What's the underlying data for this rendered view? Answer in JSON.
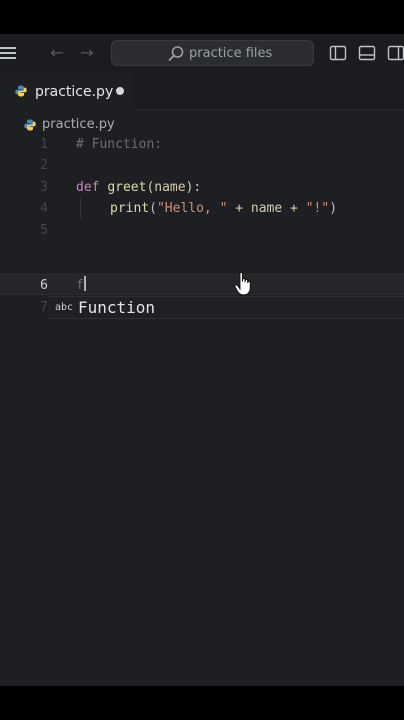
{
  "search": {
    "label": "practice files"
  },
  "tab": {
    "name": "practice.py"
  },
  "breadcrumb": {
    "file": "practice.py"
  },
  "editor": {
    "lines": [
      {
        "n": "1",
        "t": "# Function:"
      },
      {
        "n": "2",
        "t": ""
      },
      {
        "n": "3",
        "kw": "def",
        "fn": "greet",
        "params": "(name):"
      },
      {
        "n": "4",
        "fn": "print",
        "open": "(",
        "s1": "\"Hello, \"",
        "mid": " + name + ",
        "s2": "\"!\"",
        "close": ")"
      },
      {
        "n": "5",
        "t": ""
      },
      {
        "n": "6",
        "t": "f"
      },
      {
        "n": "7"
      }
    ]
  },
  "suggestion": {
    "kind": "abc",
    "text": "Function"
  },
  "colors": {
    "background": "#1e1f22",
    "keyword": "#c586c0",
    "function": "#dcdcaa",
    "string": "#ce9178",
    "comment": "#6a6e73"
  }
}
